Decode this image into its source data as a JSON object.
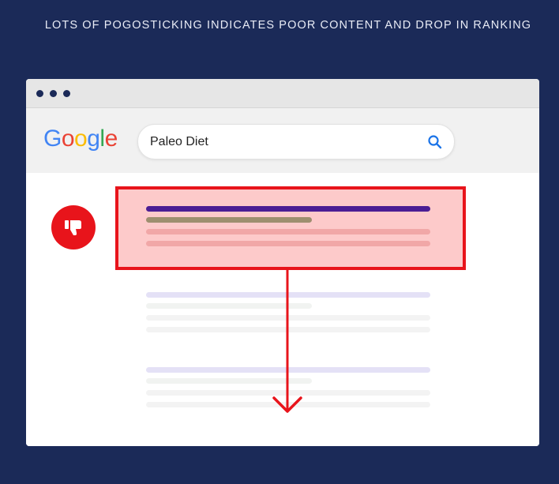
{
  "headline": "LOTS OF POGOSTICKING INDICATES POOR CONTENT AND DROP IN RANKING",
  "browser": {
    "window_dots": [
      "dot",
      "dot",
      "dot"
    ],
    "logo": {
      "letters": [
        "G",
        "o",
        "o",
        "g",
        "l",
        "e"
      ],
      "colors": [
        "#4285F4",
        "#EA4335",
        "#FBBC05",
        "#4285F4",
        "#34A853",
        "#EA4335"
      ]
    },
    "search": {
      "query": "Paleo Diet",
      "icon": "search-icon",
      "icon_color": "#1a73e8"
    }
  },
  "results": {
    "dislike_icon": "thumbs-down-icon",
    "highlight_color": "#e8141b",
    "highlight_fill": "#fdcaca",
    "arrow": "arrow-down-icon"
  },
  "colors": {
    "background": "#1b2a58",
    "title_line": "#4b1e94",
    "url_line": "#9e8f6f",
    "snippet_line": "#f1a7a7",
    "faded_title": "#e4e1f6",
    "faded_snippet": "#f1f3f1"
  }
}
